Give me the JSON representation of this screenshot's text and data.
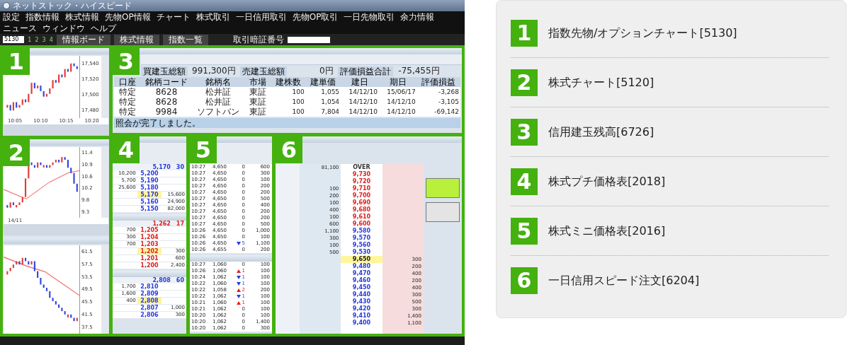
{
  "app": {
    "title": "ネットストック・ハイスピード",
    "menu": [
      "設定",
      "指数情報",
      "株式情報",
      "先物OP情報",
      "チャート",
      "株式取引",
      "一日信用取引",
      "先物OP取引",
      "一日先物取引",
      "余力情報",
      "ニュース",
      "ウィンドウ",
      "ヘルプ"
    ],
    "toolbar": {
      "code": "5130",
      "pages": [
        "1",
        "2",
        "3",
        "4"
      ],
      "buttons": [
        "情報ボード",
        "株式情報",
        "指数一覧"
      ],
      "pin_label": "取引暗証番号"
    }
  },
  "panels": {
    "p1": {
      "number": "1",
      "yticks": [
        "17,540",
        "17,520",
        "17,500",
        "17,480"
      ],
      "xticks": [
        "10:05",
        "10:10",
        "10:15",
        "10:20"
      ]
    },
    "p2": {
      "number": "2",
      "charts": [
        {
          "yticks": [
            "11.4",
            "10.9",
            "10.6",
            "10.2",
            "9.8",
            "9.3"
          ],
          "xticks": [
            "14/11"
          ]
        },
        {
          "yticks": [
            "61.5",
            "57.5",
            "53.5",
            "49.5",
            "45.5",
            "41.5",
            "37.5"
          ]
        }
      ]
    },
    "p3": {
      "number": "3",
      "summary": [
        {
          "label": "買建玉総額",
          "value": "991,300円"
        },
        {
          "label": "売建玉総額",
          "value": "0円"
        },
        {
          "label": "評価損益合計",
          "value": "-75,455円"
        }
      ],
      "columns": [
        "口座",
        "銘柄コード",
        "銘柄名",
        "市場",
        "建株数",
        "建単価",
        "建日",
        "期日",
        "評価損益"
      ],
      "rows": [
        [
          "特定",
          "8628",
          "松井証",
          "東証",
          "100",
          "1,055",
          "14/12/10",
          "15/06/17",
          "-3,268"
        ],
        [
          "特定",
          "8628",
          "松井証",
          "東証",
          "100",
          "1,054",
          "14/12/10",
          "14/12/10",
          "-3,105"
        ],
        [
          "特定",
          "9984",
          "ソフトバン",
          "東証",
          "100",
          "7,804",
          "14/12/10",
          "14/12/10",
          "-69,142"
        ]
      ],
      "status": "照会が完了しました。"
    },
    "p4": {
      "number": "4",
      "boards": [
        {
          "price": "5,170",
          "change": "30",
          "color": "#2a3bdc",
          "rows": [
            {
              "sell": "10,200",
              "price": "5,200",
              "current": false
            },
            {
              "sell": "5,700",
              "price": "5,190",
              "current": false
            },
            {
              "sell": "25,600",
              "price": "5,180",
              "current": false
            },
            {
              "price": "5,170",
              "buy": "15,600",
              "current": true
            },
            {
              "price": "5,160",
              "buy": "24,900",
              "current": false
            },
            {
              "price": "5,150",
              "buy": "82,000",
              "current": false
            }
          ]
        },
        {
          "price": "1,262",
          "change": "17",
          "color": "#e02020",
          "rows": [
            {
              "sell": "700",
              "price": "1,205",
              "current": false
            },
            {
              "sell": "300",
              "price": "1,204",
              "current": false
            },
            {
              "sell": "700",
              "price": "1,203",
              "current": false
            },
            {
              "price": "1,202",
              "buy": "300",
              "current": true
            },
            {
              "price": "1,201",
              "buy": "600",
              "current": false
            },
            {
              "price": "1,200",
              "buy": "2,400",
              "current": false
            }
          ]
        },
        {
          "price": "2,808",
          "change": "60",
          "color": "#2a3bdc",
          "rows": [
            {
              "sell": "1,700",
              "price": "2,810",
              "current": false
            },
            {
              "sell": "1,600",
              "price": "2,809",
              "current": false
            },
            {
              "sell": "400",
              "price": "2,808",
              "current": true
            },
            {
              "price": "2,807",
              "buy": "1,000",
              "current": false
            },
            {
              "price": "2,806",
              "buy": "300",
              "current": false
            }
          ]
        }
      ]
    },
    "p5": {
      "number": "5",
      "tapes": [
        {
          "rows": [
            {
              "time": "10:27",
              "price": "4,650",
              "kind": "flat",
              "change": "0",
              "qty": "600"
            },
            {
              "time": "10:27",
              "price": "4,650",
              "kind": "flat",
              "change": "0",
              "qty": "300"
            },
            {
              "time": "10:27",
              "price": "4,650",
              "kind": "flat",
              "change": "0",
              "qty": "100"
            },
            {
              "time": "10:27",
              "price": "4,650",
              "kind": "flat",
              "change": "0",
              "qty": "200"
            },
            {
              "time": "10:27",
              "price": "4,650",
              "kind": "flat",
              "change": "0",
              "qty": "200"
            },
            {
              "time": "10:27",
              "price": "4,650",
              "kind": "flat",
              "change": "0",
              "qty": "500"
            },
            {
              "time": "10:27",
              "price": "4,650",
              "kind": "flat",
              "change": "0",
              "qty": "400"
            },
            {
              "time": "10:27",
              "price": "4,650",
              "kind": "flat",
              "change": "0",
              "qty": "200"
            },
            {
              "time": "10:27",
              "price": "4,650",
              "kind": "flat",
              "change": "0",
              "qty": "200"
            },
            {
              "time": "10:27",
              "price": "4,650",
              "kind": "flat",
              "change": "0",
              "qty": "500"
            },
            {
              "time": "10:26",
              "price": "4,650",
              "kind": "flat",
              "change": "0",
              "qty": "1,000"
            },
            {
              "time": "10:26",
              "price": "4,650",
              "kind": "flat",
              "change": "0",
              "qty": "100"
            },
            {
              "time": "10:26",
              "price": "4,650",
              "kind": "down",
              "change": "5",
              "qty": "1,100"
            },
            {
              "time": "10:26",
              "price": "4,655",
              "kind": "flat",
              "change": "0",
              "qty": "200"
            }
          ]
        },
        {
          "rows": [
            {
              "time": "10:27",
              "price": "1,060",
              "kind": "flat",
              "change": "0",
              "qty": "100"
            },
            {
              "time": "10:26",
              "price": "1,060",
              "kind": "up",
              "change": "1",
              "qty": "100"
            },
            {
              "time": "10:24",
              "price": "1,062",
              "kind": "down",
              "change": "1",
              "qty": "100"
            },
            {
              "time": "10:22",
              "price": "1,060",
              "kind": "down",
              "change": "1",
              "qty": "100"
            },
            {
              "time": "10:22",
              "price": "1,058",
              "kind": "up",
              "change": "2",
              "qty": "200"
            },
            {
              "time": "10:22",
              "price": "1,062",
              "kind": "down",
              "change": "1",
              "qty": "100"
            },
            {
              "time": "10:21",
              "price": "1,060",
              "kind": "up",
              "change": "1",
              "qty": "100"
            },
            {
              "time": "10:21",
              "price": "1,062",
              "kind": "flat",
              "change": "0",
              "qty": "100"
            },
            {
              "time": "10:20",
              "price": "1,062",
              "kind": "flat",
              "change": "0",
              "qty": "100"
            },
            {
              "time": "10:20",
              "price": "1,062",
              "kind": "flat",
              "change": "0",
              "qty": "1,400"
            },
            {
              "time": "10:20",
              "price": "1,062",
              "kind": "flat",
              "change": "0",
              "qty": "300"
            }
          ]
        }
      ]
    },
    "p6": {
      "number": "6",
      "ladder": [
        {
          "sell": "81,100",
          "price": "OVER",
          "color": "#333333",
          "current": false
        },
        {
          "price": "9,730",
          "color": "#e02020",
          "current": false
        },
        {
          "price": "9,720",
          "color": "#e02020",
          "current": false
        },
        {
          "sell": "100",
          "price": "9,710",
          "color": "#e02020",
          "current": false
        },
        {
          "sell": "200",
          "price": "9,700",
          "color": "#e02020",
          "current": false
        },
        {
          "sell": "100",
          "price": "9,690",
          "color": "#e02020",
          "current": false
        },
        {
          "sell": "400",
          "price": "9,680",
          "color": "#e02020",
          "current": false
        },
        {
          "sell": "100",
          "price": "9,610",
          "color": "#e02020",
          "current": false
        },
        {
          "sell": "600",
          "price": "9,600",
          "color": "#e02020",
          "current": false
        },
        {
          "sell": "1,100",
          "price": "9,580",
          "color": "#2a3bdc",
          "current": false
        },
        {
          "sell": "300",
          "price": "9,570",
          "color": "#2a3bdc",
          "current": false
        },
        {
          "sell": "100",
          "price": "9,560",
          "color": "#2a3bdc",
          "current": false
        },
        {
          "sell": "500",
          "price": "9,530",
          "color": "#2a3bdc",
          "current": false
        },
        {
          "price": "9,650",
          "buy": "300",
          "current": true
        },
        {
          "price": "9,480",
          "buy": "200",
          "color": "#2a3bdc",
          "current": false
        },
        {
          "price": "9,470",
          "buy": "400",
          "color": "#2a3bdc",
          "current": false
        },
        {
          "price": "9,460",
          "buy": "200",
          "color": "#2a3bdc",
          "current": false
        },
        {
          "price": "9,450",
          "buy": "400",
          "color": "#2a3bdc",
          "current": false
        },
        {
          "price": "9,440",
          "buy": "300",
          "color": "#2a3bdc",
          "current": false
        },
        {
          "price": "9,430",
          "buy": "500",
          "color": "#2a3bdc",
          "current": false
        },
        {
          "price": "9,420",
          "buy": "300",
          "color": "#2a3bdc",
          "current": false
        },
        {
          "price": "9,410",
          "buy": "1,400",
          "color": "#2a3bdc",
          "current": false
        },
        {
          "price": "9,400",
          "buy": "1,100",
          "color": "#2a3bdc",
          "current": false
        }
      ]
    }
  },
  "legend": [
    {
      "number": "1",
      "label": "指数先物/オプションチャート[5130]"
    },
    {
      "number": "2",
      "label": "株式チャート[5120]"
    },
    {
      "number": "3",
      "label": "信用建玉残高[6726]"
    },
    {
      "number": "4",
      "label": "株式プチ価格表[2018]"
    },
    {
      "number": "5",
      "label": "株式ミニ価格表[2016]"
    },
    {
      "number": "6",
      "label": "一日信用スピード注文[6204]"
    }
  ]
}
